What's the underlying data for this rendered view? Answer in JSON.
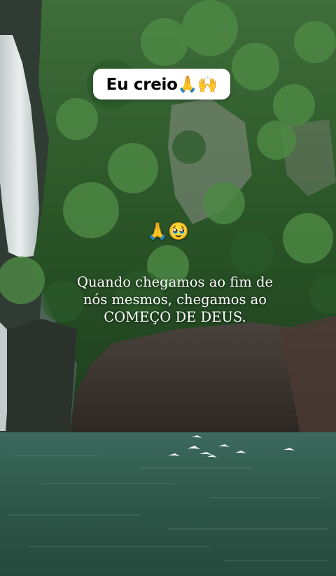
{
  "caption": {
    "text": "Eu creio🙏🙌"
  },
  "emoji_line": "🙏🥹",
  "quote": {
    "lines": [
      "Quando chegamos ao fim de",
      "nós mesmos, chegamos ao",
      "COMEÇO DE DEUS."
    ]
  },
  "colors": {
    "water": "#2f5b4d",
    "forest": "#2d5a2a",
    "rock": "#3d3632",
    "waterfall": "#e8eef0"
  }
}
